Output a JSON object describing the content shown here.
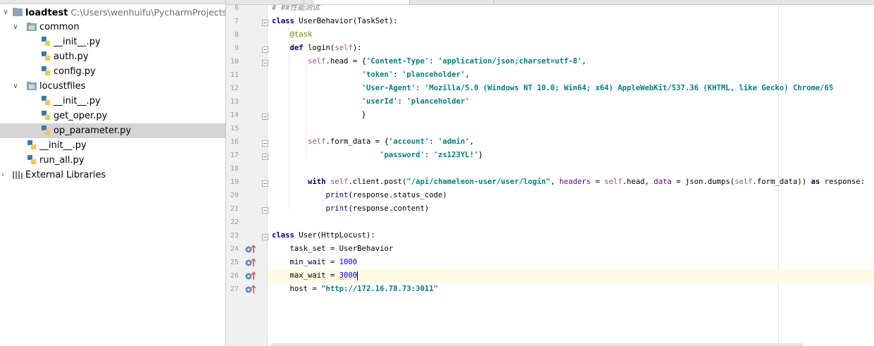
{
  "project_tree": {
    "root": {
      "name": "loadtest",
      "path": "C:\\Users\\wenhuifu\\PycharmProjects\\loa"
    },
    "common": {
      "label": "common",
      "files": [
        "__init__.py",
        "auth.py",
        "config.py"
      ]
    },
    "locustfiles": {
      "label": "locustfiles",
      "files": [
        "__init__.py",
        "get_oper.py",
        "op_parameter.py"
      ]
    },
    "root_files": [
      "__init__.py",
      "run_all.py"
    ],
    "external_libraries": "External Libraries"
  },
  "editor": {
    "line_numbers": [
      "6",
      "7",
      "8",
      "9",
      "10",
      "11",
      "12",
      "13",
      "14",
      "15",
      "16",
      "17",
      "18",
      "19",
      "20",
      "21",
      "22",
      "23",
      "24",
      "25",
      "26",
      "27"
    ],
    "current_line": "26",
    "lines": [
      [
        [
          "cm",
          "# ##性能测试"
        ]
      ],
      [
        [
          "kw",
          "class "
        ],
        [
          "",
          "UserBehavior(TaskSet):"
        ]
      ],
      [
        [
          "",
          "    "
        ],
        [
          "dc",
          "@task"
        ]
      ],
      [
        [
          "",
          "    "
        ],
        [
          "kw",
          "def "
        ],
        [
          "",
          "login("
        ],
        [
          "sf",
          "self"
        ],
        [
          "",
          "):"
        ]
      ],
      [
        [
          "",
          "        "
        ],
        [
          "sf",
          "self"
        ],
        [
          "",
          ".head = {"
        ],
        [
          "st",
          "'Content-Type'"
        ],
        [
          "",
          ": "
        ],
        [
          "st",
          "'application/json;charset=utf-8'"
        ],
        [
          "",
          ","
        ]
      ],
      [
        [
          "",
          "                    "
        ],
        [
          "st",
          "'token'"
        ],
        [
          "",
          ": "
        ],
        [
          "st",
          "'planceholder'"
        ],
        [
          "",
          ","
        ]
      ],
      [
        [
          "",
          "                    "
        ],
        [
          "st",
          "'User-Agent'"
        ],
        [
          "",
          ": "
        ],
        [
          "st",
          "'Mozilla/5.0 (Windows NT 10.0; Win64; x64) AppleWebKit/537.36 (KHTML, like Gecko) Chrome/65"
        ]
      ],
      [
        [
          "",
          "                    "
        ],
        [
          "st",
          "'userId'"
        ],
        [
          "",
          ": "
        ],
        [
          "st",
          "'planceholder'"
        ]
      ],
      [
        [
          "",
          "                    }"
        ]
      ],
      [
        [
          "",
          ""
        ]
      ],
      [
        [
          "",
          "        "
        ],
        [
          "sf",
          "self"
        ],
        [
          "",
          ".form_data = {"
        ],
        [
          "st",
          "'account'"
        ],
        [
          "",
          ": "
        ],
        [
          "st",
          "'admin'"
        ],
        [
          "",
          ","
        ]
      ],
      [
        [
          "",
          "                        "
        ],
        [
          "st",
          "'password'"
        ],
        [
          "",
          ": "
        ],
        [
          "st",
          "'zs123YL!'"
        ],
        [
          "",
          "}"
        ]
      ],
      [
        [
          "",
          ""
        ]
      ],
      [
        [
          "",
          "        "
        ],
        [
          "kw",
          "with "
        ],
        [
          "sf",
          "self"
        ],
        [
          "",
          ".client.post("
        ],
        [
          "st",
          "\"/api/chameleon-user/user/login\""
        ],
        [
          "",
          ", "
        ],
        [
          "pm",
          "headers"
        ],
        [
          "",
          " = "
        ],
        [
          "sf",
          "self"
        ],
        [
          "",
          ".head, "
        ],
        [
          "pm",
          "data"
        ],
        [
          "",
          " = json.dumps("
        ],
        [
          "sf",
          "self"
        ],
        [
          "",
          ".form_data)) "
        ],
        [
          "kw",
          "as "
        ],
        [
          "",
          "response:"
        ]
      ],
      [
        [
          "",
          "            "
        ],
        [
          "bi",
          "print"
        ],
        [
          "",
          "(response.status_code)"
        ]
      ],
      [
        [
          "",
          "            "
        ],
        [
          "bi",
          "print"
        ],
        [
          "",
          "(response.content)"
        ]
      ],
      [
        [
          "",
          ""
        ]
      ],
      [
        [
          "kw",
          "class "
        ],
        [
          "",
          "User(HttpLocust):"
        ]
      ],
      [
        [
          "",
          "    task_set = UserBehavior"
        ]
      ],
      [
        [
          "",
          "    min_wait = "
        ],
        [
          "nm",
          "1000"
        ]
      ],
      [
        [
          "",
          "    max_wait = "
        ],
        [
          "nm",
          "3000"
        ]
      ],
      [
        [
          "",
          "    host = "
        ],
        [
          "st",
          "\"http://172.16.78.73:3011\""
        ]
      ]
    ]
  }
}
